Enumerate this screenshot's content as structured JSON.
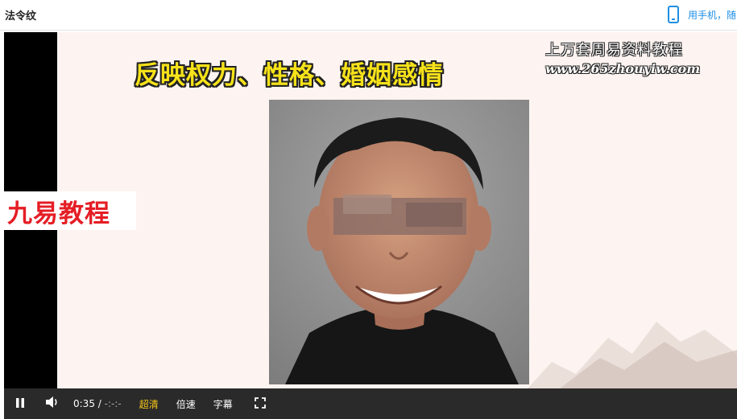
{
  "page": {
    "title": "法令纹"
  },
  "header": {
    "mobile_text": "用手机，随"
  },
  "video": {
    "slide_title": "反映权力、性格、婚姻感情",
    "watermark_line1": "上万套周易资料教程",
    "watermark_line2": "www.265zhouyiw.com",
    "brand": "九易教程"
  },
  "controls": {
    "current_time": "0:35",
    "separator": "/",
    "duration": "-:-:-",
    "quality": "超清",
    "speed": "倍速",
    "subtitles": "字幕"
  },
  "colors": {
    "accent": "#1f8fe5",
    "title_yellow": "#f6e21a",
    "brand_red": "#e51d25",
    "quality_yellow": "#f5c518"
  },
  "icons": {
    "phone": "phone-icon",
    "pause": "pause-icon",
    "volume": "volume-icon",
    "fullscreen": "fullscreen-icon"
  }
}
